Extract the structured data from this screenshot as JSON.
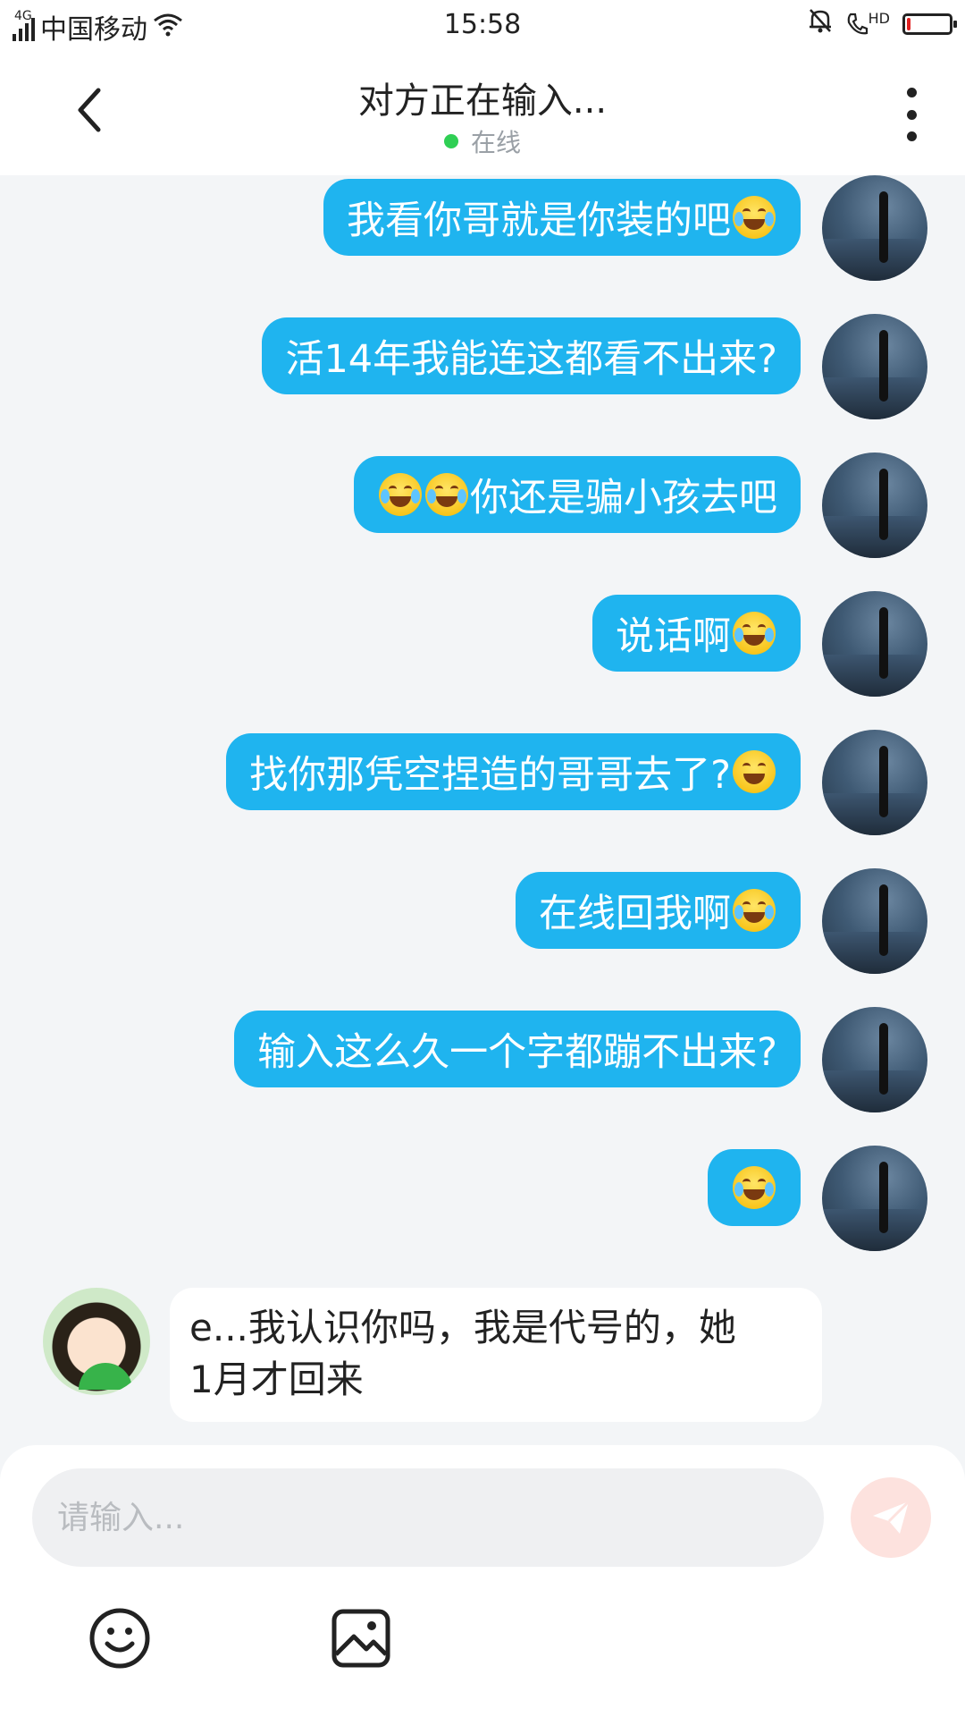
{
  "status_bar": {
    "network_tag": "4G",
    "carrier": "中国移动",
    "time": "15:58",
    "hd_label": "HD",
    "battery_level": 0.08
  },
  "header": {
    "title": "对方正在输入...",
    "status": "在线"
  },
  "messages_out": [
    {
      "text": "我看你哥就是你装的吧",
      "emoji_after": [
        "cry-laugh"
      ]
    },
    {
      "text": "活14年我能连这都看不出来?",
      "emoji_after": []
    },
    {
      "text": "你还是骗小孩去吧",
      "emoji_before": [
        "cry-laugh",
        "cry-laugh"
      ]
    },
    {
      "text": "说话啊",
      "emoji_after": [
        "cry-laugh"
      ]
    },
    {
      "text": "找你那凭空捏造的哥哥去了?",
      "emoji_after": [
        "grin"
      ]
    },
    {
      "text": "在线回我啊",
      "emoji_after": [
        "cry-laugh"
      ]
    },
    {
      "text": "输入这么久一个字都蹦不出来?",
      "emoji_after": []
    },
    {
      "text": "",
      "emoji_after": [
        "cry-laugh"
      ]
    }
  ],
  "message_in": {
    "line1": "e...我认识你吗，我是代号的，她",
    "line2": "1月才回来"
  },
  "composer": {
    "placeholder": "请输入..."
  },
  "colors": {
    "bubble_out": "#1fb4ef",
    "online_dot": "#2fcf54",
    "send_button": "#fde2de"
  }
}
